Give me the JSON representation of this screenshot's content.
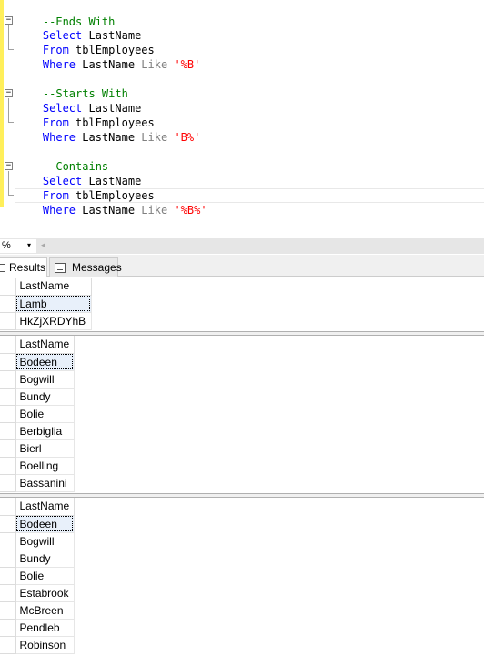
{
  "editor": {
    "block1": {
      "comment": "--Ends With",
      "select_kw": "Select",
      "select_col": "LastName",
      "from_kw": "From",
      "from_table": "tblEmployees",
      "where_kw": "Where",
      "where_col": "LastName",
      "like_kw": "Like",
      "pattern": "'%B'"
    },
    "block2": {
      "comment": "--Starts With",
      "select_kw": "Select",
      "select_col": "LastName",
      "from_kw": "From",
      "from_table": "tblEmployees",
      "where_kw": "Where",
      "where_col": "LastName",
      "like_kw": "Like",
      "pattern": "'B%'"
    },
    "block3": {
      "comment": "--Contains",
      "select_kw": "Select",
      "select_col": "LastName",
      "from_kw": "From",
      "from_table": "tblEmployees",
      "where_kw": "Where",
      "where_col": "LastName",
      "like_kw": "Like",
      "pattern": "'%B%'"
    },
    "fold_glyph": "−"
  },
  "zoom": {
    "value": "%",
    "arrow": "▾",
    "scroll_left": "◂"
  },
  "tabs": {
    "results": "Results",
    "messages": "Messages"
  },
  "grid1": {
    "header": "LastName",
    "rows": [
      "Lamb",
      "HkZjXRDYhB"
    ]
  },
  "grid2": {
    "header": "LastName",
    "rows": [
      "Bodeen",
      "Bogwill",
      "Bundy",
      "Bolie",
      "Berbiglia",
      "Bierl",
      "Boelling",
      "Bassanini"
    ]
  },
  "grid3": {
    "header": "LastName",
    "rows": [
      "Bodeen",
      "Bogwill",
      "Bundy",
      "Bolie",
      "Estabrook",
      "McBreen",
      "Pendleb",
      "Robinson"
    ]
  },
  "colors": {
    "keyword": "#0000ff",
    "operator": "#808080",
    "string": "#ff0000",
    "comment": "#008000",
    "change_bar": "#ffef5a"
  }
}
